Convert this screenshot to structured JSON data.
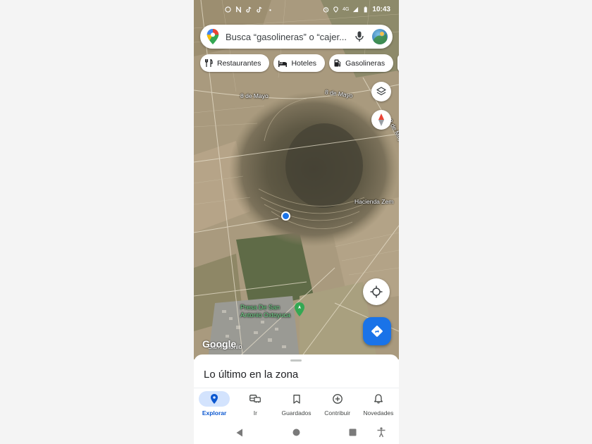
{
  "status_bar": {
    "time": "10:43",
    "network": "4G",
    "left_icons": [
      "whatsapp-icon",
      "n-icon",
      "tiktok-icon",
      "tiktok-icon",
      "dot-icon"
    ],
    "right_icons": [
      "alarm-icon",
      "location-icon",
      "signal-icon",
      "battery-icon"
    ]
  },
  "search": {
    "placeholder": "Busca “gasolineras” o “cajer...",
    "icons": [
      "maps-pin-icon",
      "mic-icon",
      "avatar"
    ]
  },
  "chips": [
    {
      "label": "Restaurantes",
      "icon": "fork-knife-icon"
    },
    {
      "label": "Hoteles",
      "icon": "bed-icon"
    },
    {
      "label": "Gasolineras",
      "icon": "gas-pump-icon"
    }
  ],
  "map": {
    "road_labels": [
      "8 de Mayo",
      "8 de Mayo",
      "8 de Mayo"
    ],
    "place_label": "Hacienda Zem",
    "poi": {
      "line1": "Presa De San",
      "line2": "Antonio Oxtoyuca"
    },
    "town": "San Antonio",
    "attribution": "Google"
  },
  "sheet": {
    "title": "Lo último en la zona"
  },
  "bottom_nav": [
    {
      "label": "Explorar",
      "icon": "explore-pin-icon",
      "active": true
    },
    {
      "label": "Ir",
      "icon": "commute-icon",
      "active": false
    },
    {
      "label": "Guardados",
      "icon": "bookmark-icon",
      "active": false
    },
    {
      "label": "Contribuir",
      "icon": "add-circle-icon",
      "active": false
    },
    {
      "label": "Novedades",
      "icon": "bell-icon",
      "active": false
    }
  ],
  "colors": {
    "accent": "#1a73e8",
    "active_nav_bg": "#d3e3fd",
    "poi_green": "#6fd98a"
  }
}
